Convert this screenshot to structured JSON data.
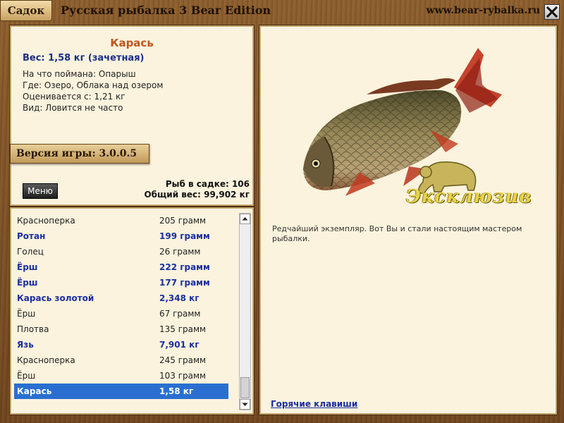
{
  "titlebar": {
    "tab_label": "Садок",
    "app_title": "Русская рыбалка 3 Bear Edition",
    "site_url": "www.bear-rybalka.ru"
  },
  "info": {
    "fish_name": "Карась",
    "weight": "Вес: 1,58 кг (зачетная)",
    "caught_with": "На что поймана: Опарыш",
    "where": "Где: Озеро, Облака над озером",
    "rated_from": "Оценивается с: 1,21 кг",
    "kind": "Вид: Ловится не часто",
    "version": "Версия игры: 3.0.0.5",
    "menu_label": "Меню",
    "fish_count": "Рыб в садке: 106",
    "total_weight": "Общий вес: 99,902 кг"
  },
  "catch_list": [
    {
      "name": "Красноперка",
      "weight": "205 грамм"
    },
    {
      "name": "Ротан",
      "weight": "199 грамм"
    },
    {
      "name": "Голец",
      "weight": "26 грамм"
    },
    {
      "name": "Ёрш",
      "weight": "222 грамм"
    },
    {
      "name": "Ёрш",
      "weight": "177 грамм"
    },
    {
      "name": "Карась золотой",
      "weight": "2,348 кг"
    },
    {
      "name": "Ёрш",
      "weight": "67 грамм"
    },
    {
      "name": "Плотва",
      "weight": "135 грамм"
    },
    {
      "name": "Язь",
      "weight": "7,901 кг"
    },
    {
      "name": "Красноперка",
      "weight": "245 грамм"
    },
    {
      "name": "Ёрш",
      "weight": "103 грамм"
    },
    {
      "name": "Карась",
      "weight": "1,58 кг"
    }
  ],
  "catch_state": {
    "highlighted": [
      1,
      3,
      4,
      5,
      8
    ],
    "selected": 11
  },
  "detail": {
    "exclusive_label": "Эксклюзив",
    "description": "Редчайший экземпляр. Вот Вы и стали настоящим мастером рыбалки.",
    "hotkeys_link": "Горячие клавиши"
  },
  "colors": {
    "accent_name": "#c0541a",
    "highlight_text": "#1a2ea0",
    "selection": "#2a6fd0",
    "panel_bg": "#fbf3dd"
  },
  "icons": {
    "close": "close-icon",
    "scroll_up": "arrow-up-icon",
    "scroll_down": "arrow-down-icon",
    "fish": "crucian-carp-image",
    "bear": "bear-icon"
  }
}
